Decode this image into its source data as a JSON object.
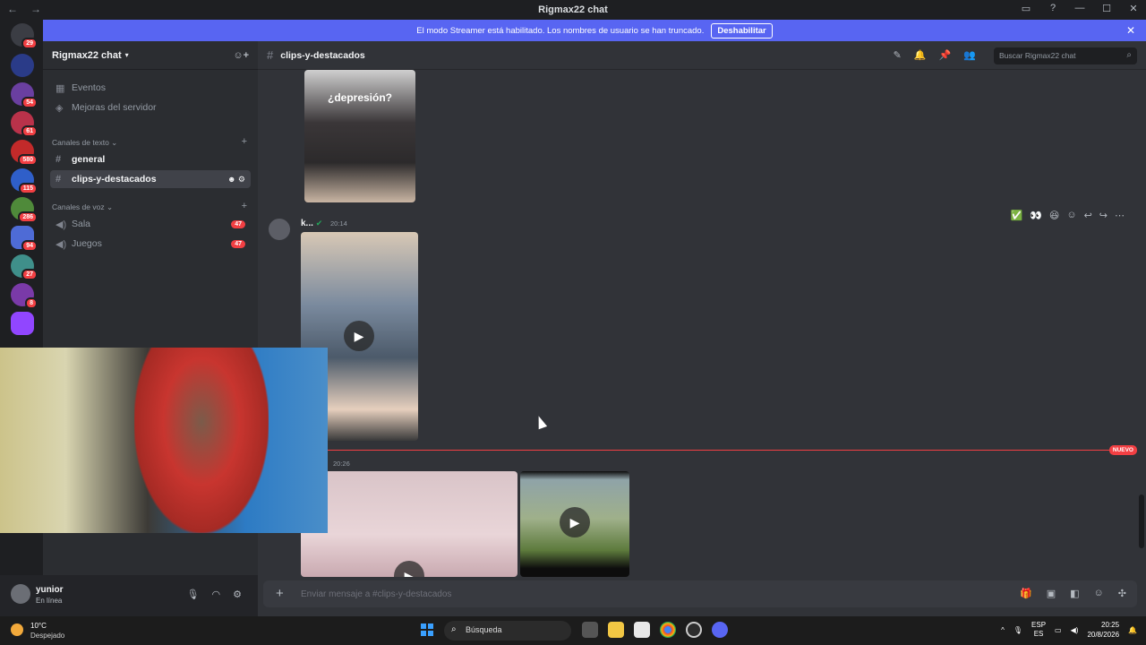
{
  "window": {
    "title": "Rigmax22 chat",
    "nav_back": "←",
    "nav_fwd": "→",
    "controls": [
      "▭",
      "?",
      "—",
      "☐",
      "✕"
    ]
  },
  "banner": {
    "text": "El modo Streamer está habilitado. Los nombres de usuario se han truncado.",
    "button": "Deshabilitar",
    "close": "✕"
  },
  "guilds": [
    {
      "badge": "29",
      "color": "#3b3d44"
    },
    {
      "badge": "",
      "color": "#2a3b88"
    },
    {
      "badge": "54",
      "color": "#6a3fa0"
    },
    {
      "badge": "61",
      "color": "#b9324a"
    },
    {
      "badge": "580",
      "color": "#c22a2a"
    },
    {
      "badge": "115",
      "color": "#2f5fc9"
    },
    {
      "badge": "286",
      "color": "#4f8a3a"
    },
    {
      "badge": "94",
      "color": "#4e6bd6"
    },
    {
      "badge": "27",
      "color": "#3f8f8a"
    },
    {
      "badge": "8",
      "color": "#7a3aa8"
    },
    {
      "badge": "",
      "color": "#9146ff"
    }
  ],
  "server": {
    "name": "Rigmax22 chat",
    "items": {
      "events": "Eventos",
      "boosts": "Mejoras del servidor"
    },
    "text_category": "Canales de texto",
    "voice_category": "Canales de voz",
    "text_channels": [
      "general",
      "clips-y-destacados"
    ],
    "voice_channels": [
      {
        "name": "Sala",
        "count": "47"
      },
      {
        "name": "Juegos",
        "count": "47"
      }
    ]
  },
  "user": {
    "name": "yunior",
    "status": "En línea"
  },
  "channel": {
    "name": "clips-y-destacados",
    "search_placeholder": "Buscar Rigmax22 chat",
    "composer_placeholder": "Enviar mensaje a #clips-y-destacados"
  },
  "messages": [
    {
      "overlay_text": "¿depresión?"
    },
    {
      "author": "k...",
      "time": "20:14"
    },
    {
      "author": "",
      "time": "20:26"
    }
  ],
  "new_label": "NUEVO",
  "taskbar": {
    "temp": "10°C",
    "condition": "Despejado",
    "search": "Búsqueda",
    "lang1": "ESP",
    "lang2": "ES",
    "time": "20:25",
    "date": "20/8/2026"
  }
}
